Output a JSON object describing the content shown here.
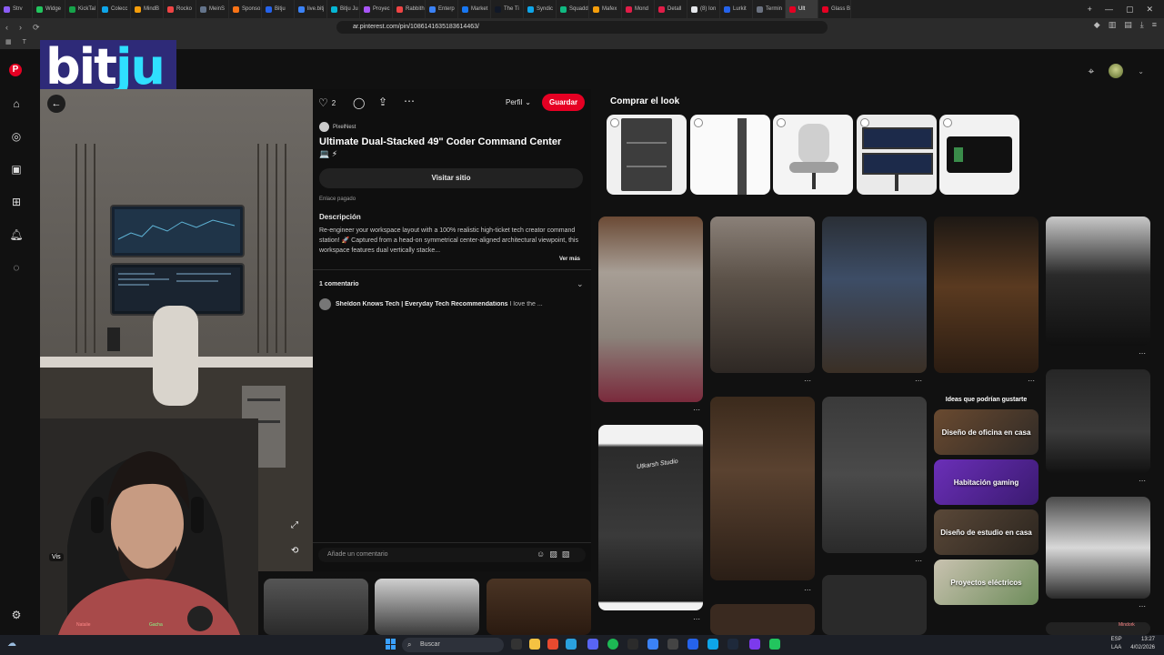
{
  "browser": {
    "tabs": [
      "Strv",
      "Widge",
      "KickTal",
      "Colecc",
      "MindB",
      "Rocko",
      "MeinS",
      "Sponso",
      "Bitju",
      "live.bitj",
      "Bitju Ju",
      "Proyec",
      "Rabbith",
      "Enterp",
      "Market",
      "The Ti",
      "Syndic",
      "Squadd",
      "Mafex",
      "Mond",
      "Detall",
      "(8) Ion",
      "Lurkit",
      "Termin",
      "Ult",
      "Glass B"
    ],
    "active_tab": "Ult",
    "url": "ar.pinterest.com/pin/1086141635183614463/",
    "bookmark_label": "T"
  },
  "colors": {
    "accent": "#e60023",
    "bg": "#111111",
    "panel": "#0f0f0f"
  },
  "brand_overlay": {
    "text_main": "bit",
    "text_accent": "ju"
  },
  "pin": {
    "like_count": "2",
    "profile_label": "Perfil",
    "save_label": "Guardar",
    "source_name": "PixelNest",
    "title": "Ultimate Dual-Stacked 49\" Coder Command Center",
    "title_emoji": "💻 ⚡",
    "visit_label": "Visitar sitio",
    "paid_link": "Enlace pagado",
    "description_heading": "Descripción",
    "description": "Re-engineer your workspace layout with a 100% realistic high-ticket tech creator command station! 🚀 Captured from a head-on symmetrical center-aligned architectural viewpoint, this workspace features dual vertically stacke...",
    "see_more": "Ver más",
    "comments_heading": "1 comentario",
    "comment_author": "Sheldon Knows Tech | Everyday Tech Recommendations",
    "comment_text": "I love the ...",
    "add_comment_placeholder": "Añade un comentario",
    "visit_overlay": "Vis"
  },
  "shop": {
    "heading": "Comprar el look"
  },
  "ideas": {
    "heading": "Ideas que podrían gustarte",
    "items": [
      "Diseño de oficina en casa",
      "Habitación gaming",
      "Diseño de estudio en casa",
      "Proyectos eléctricos"
    ]
  },
  "grid": {
    "studio_sign": "Utkarsh Studio"
  },
  "taskbar": {
    "search_label": "Buscar",
    "lang": "ESP",
    "lang2": "LAA",
    "time": "13:27",
    "date": "4/02/2026"
  },
  "webcam": {
    "label_left": "Natalie",
    "label_mid": "Gacha",
    "label_right": "Mindork"
  }
}
